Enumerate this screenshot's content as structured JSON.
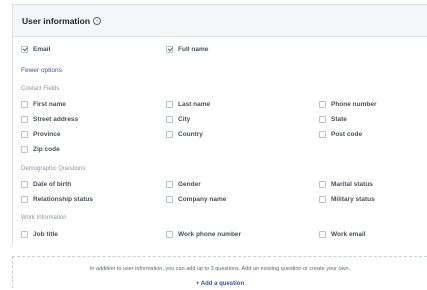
{
  "header": {
    "title": "User information"
  },
  "primary": {
    "email": "Email",
    "full_name": "Full name"
  },
  "fewer_options": "Fewer options",
  "contact": {
    "title": "Contact Fields",
    "first_name": "First name",
    "last_name": "Last name",
    "phone_number": "Phone number",
    "street_address": "Street address",
    "city": "City",
    "state": "State",
    "province": "Province",
    "country": "Country",
    "post_code": "Post code",
    "zip_code": "Zip code"
  },
  "demographic": {
    "title": "Demographic Questions",
    "date_of_birth": "Date of birth",
    "gender": "Gender",
    "marital_status": "Marital status",
    "relationship_status": "Relationship status",
    "company_name": "Company name",
    "military_status": "Military status"
  },
  "work": {
    "title": "Work Information",
    "job_title": "Job title",
    "work_phone": "Work phone number",
    "work_email": "Work email"
  },
  "footer": {
    "text": "In addition to user information, you can add up to 3 questions. Add an existing question or create your own.",
    "add_question": "+ Add a question"
  }
}
